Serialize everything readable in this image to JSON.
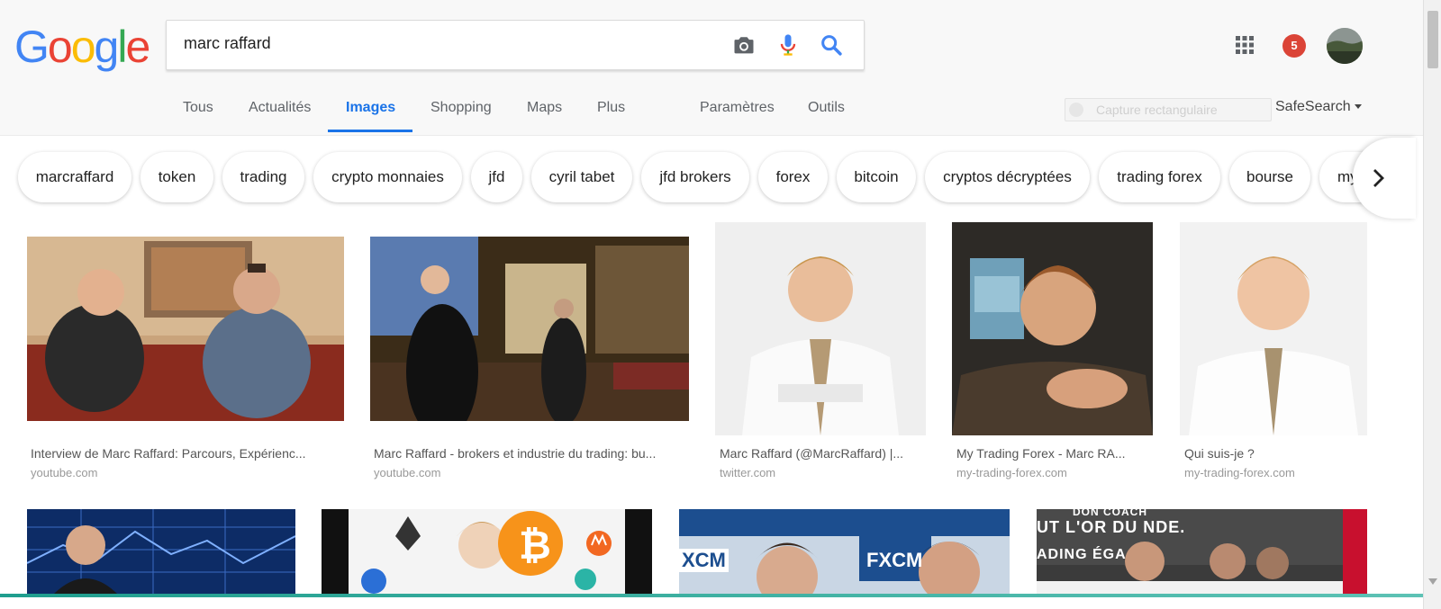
{
  "search": {
    "query": "marc raffard"
  },
  "header": {
    "notification_count": "5"
  },
  "tabs": [
    {
      "label": "Tous"
    },
    {
      "label": "Actualités"
    },
    {
      "label": "Images"
    },
    {
      "label": "Shopping"
    },
    {
      "label": "Maps"
    },
    {
      "label": "Plus"
    },
    {
      "label": "Paramètres"
    },
    {
      "label": "Outils"
    }
  ],
  "tools": {
    "capture_placeholder": "Capture rectangulaire",
    "safesearch_label": "SafeSearch"
  },
  "chips": [
    "marcraffard",
    "token",
    "trading",
    "crypto monnaies",
    "jfd",
    "cyril tabet",
    "jfd brokers",
    "forex",
    "bitcoin",
    "cryptos décryptées",
    "trading forex",
    "bourse",
    "my"
  ],
  "results": [
    {
      "caption": "Interview de Marc Raffard: Parcours, Expérienc...",
      "domain": "youtube.com"
    },
    {
      "caption": "Marc Raffard - brokers et industrie du trading: bu...",
      "domain": "youtube.com"
    },
    {
      "caption": "Marc Raffard (@MarcRaffard) |...",
      "domain": "twitter.com"
    },
    {
      "caption": "My Trading Forex - Marc RA...",
      "domain": "my-trading-forex.com"
    },
    {
      "caption": "Qui suis-je ?",
      "domain": "my-trading-forex.com"
    }
  ],
  "row2_texts": {
    "fxcm_1": "FXCM",
    "fxcm_2": "XCM",
    "banner": "UT L'OR DU  NDE.",
    "banner_top": "DON COACH",
    "banner_bottom": "ADING ÉGA"
  },
  "colors": {
    "accent": "#1a73e8",
    "google_blue": "#4285f4",
    "google_red": "#ea4335",
    "google_yellow": "#fbbc05",
    "google_green": "#34a853",
    "notification": "#db4437"
  }
}
